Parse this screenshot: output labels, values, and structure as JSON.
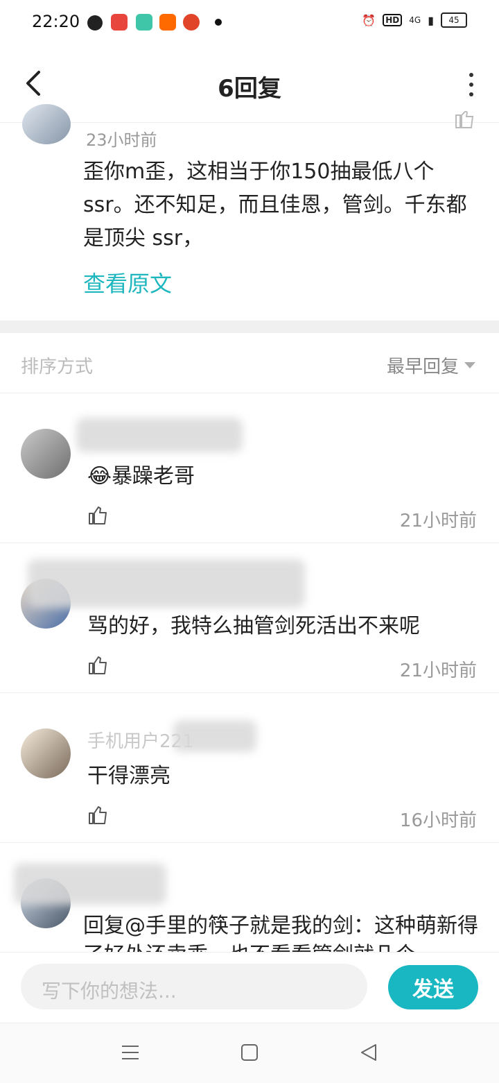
{
  "status_bar": {
    "time": "22:20",
    "net_label": "HD",
    "signal_label": "4G",
    "battery": "45"
  },
  "header": {
    "title": "6回复"
  },
  "post": {
    "time": "23小时前",
    "text": "歪你m歪，这相当于你150抽最低八个ssr。还不知足，而且佳恩，管剑。千东都是顶尖 ssr，",
    "link": "查看原文"
  },
  "sort": {
    "label": "排序方式",
    "value": "最早回复"
  },
  "comments": [
    {
      "emoji": "😂",
      "text": "暴躁老哥",
      "time": "21小时前"
    },
    {
      "text": "骂的好，我特么抽管剑死活出不来呢",
      "time": "21小时前"
    },
    {
      "name": "手机用户221",
      "text": "干得漂亮",
      "time": "16小时前"
    },
    {
      "text": "回复@手里的筷子就是我的剑：这种萌新得了好处还卖乖，也不看看管剑就几个"
    }
  ],
  "composer": {
    "placeholder": "写下你的想法...",
    "send_label": "发送"
  },
  "colors": {
    "accent": "#19b7c2",
    "link": "#1fb7bf"
  }
}
